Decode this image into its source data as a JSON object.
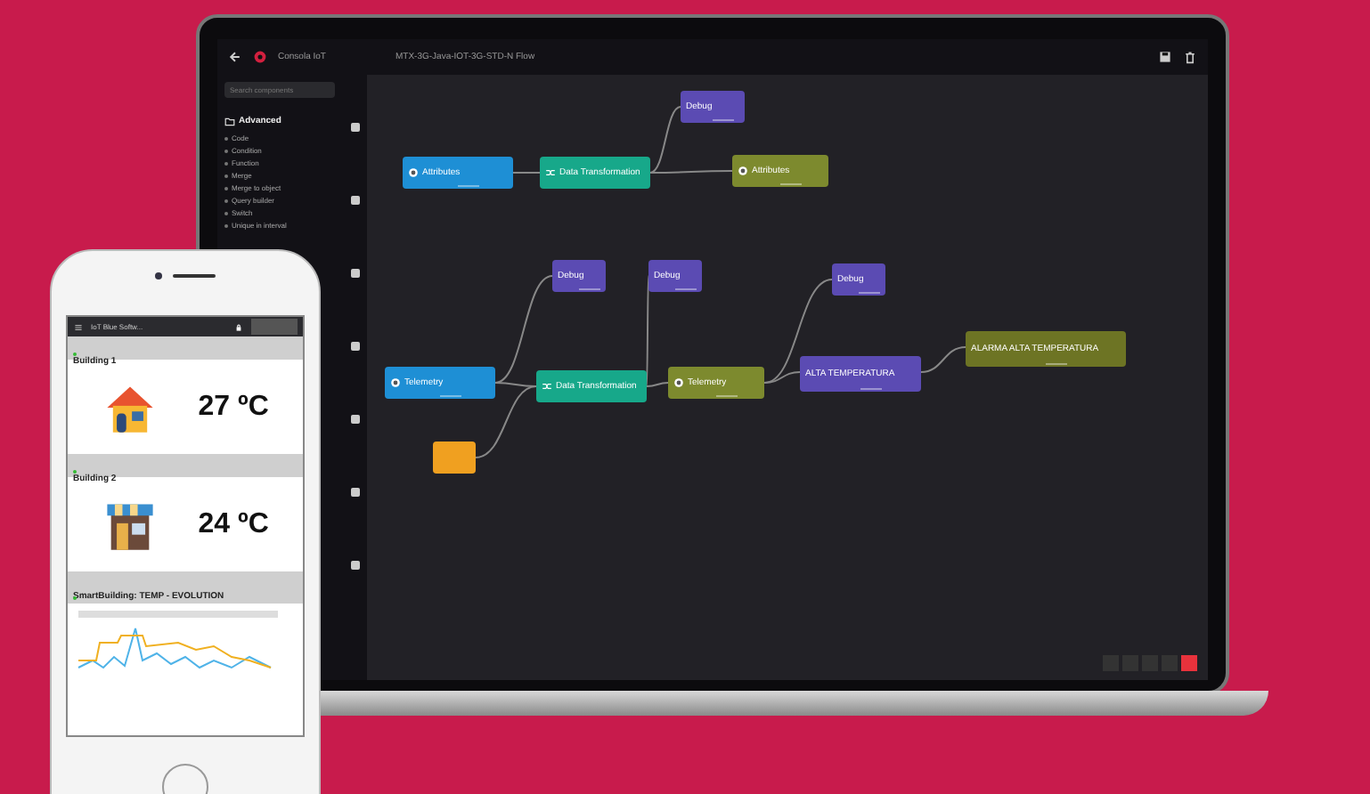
{
  "laptop": {
    "app_name": "Consola IoT",
    "flow_title": "MTX-3G-Java-IOT-3G-STD-N Flow",
    "sidebar": {
      "search": {
        "placeholder": "Search components"
      },
      "section": "Advanced",
      "items": [
        "Code",
        "Condition",
        "Function",
        "Merge",
        "Merge to object",
        "Query builder",
        "Switch",
        "Unique in interval"
      ]
    },
    "nodes": [
      {
        "kind": "input",
        "title": "Attributes",
        "color": "#1e8fd5"
      },
      {
        "kind": "transform",
        "title": "Data Transformation",
        "color": "#17a88a"
      },
      {
        "kind": "debug",
        "title": "Debug",
        "color": "#5b4bb3"
      },
      {
        "kind": "output",
        "title": "Attributes",
        "color": "#7d8a2e"
      },
      {
        "kind": "debug",
        "title": "Debug",
        "color": "#5b4bb3"
      },
      {
        "kind": "debug",
        "title": "Debug",
        "color": "#5b4bb3"
      },
      {
        "kind": "debug",
        "title": "Debug",
        "color": "#5b4bb3"
      },
      {
        "kind": "input",
        "title": "Telemetry",
        "color": "#1e8fd5"
      },
      {
        "kind": "transform",
        "title": "Data Transformation",
        "color": "#17a88a"
      },
      {
        "kind": "output",
        "title": "Telemetry",
        "color": "#7d8a2e"
      },
      {
        "kind": "rule",
        "title": "ALTA TEMPERATURA",
        "color": "#5b4bb3"
      },
      {
        "kind": "alarm",
        "title": "ALARMA ALTA TEMPERATURA",
        "color": "#6d7424"
      },
      {
        "kind": "trigger",
        "color": "#f0a020"
      }
    ]
  },
  "phone": {
    "app_title": "IoT Blue Softw...",
    "widgets": [
      {
        "kind": "temp",
        "title": "Building 1",
        "value": "27 ºC"
      },
      {
        "kind": "temp",
        "title": "Building 2",
        "value": "24 ºC"
      },
      {
        "kind": "chart",
        "title": "SmartBuilding: TEMP - EVOLUTION"
      }
    ]
  }
}
